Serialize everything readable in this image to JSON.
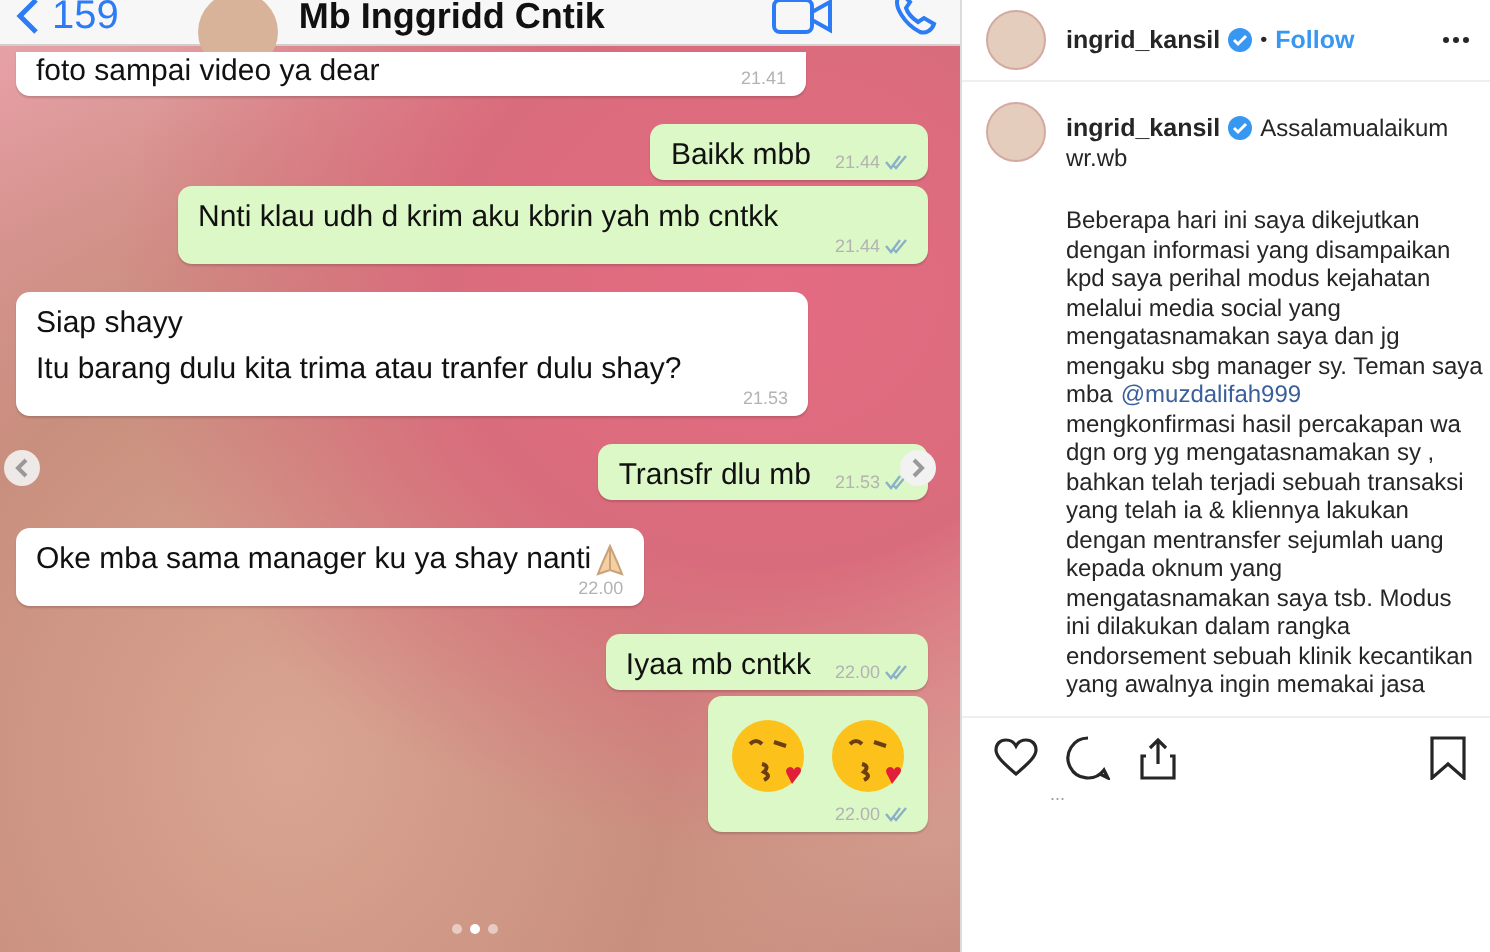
{
  "chat": {
    "back_count": "159",
    "contact": "Mb Inggridd Cntik",
    "messages": [
      {
        "kind": "in",
        "lines": [
          "foto sampai video ya dear"
        ],
        "time": "21.41"
      },
      {
        "kind": "out",
        "lines": [
          "Baikk mbb"
        ],
        "time": "21.44"
      },
      {
        "kind": "out",
        "lines": [
          "Nnti klau udh d krim aku kbrin yah mb cntkk"
        ],
        "time": "21.44"
      },
      {
        "kind": "in",
        "lines": [
          "Siap shayy",
          "Itu barang dulu kita trima atau tranfer dulu shay?"
        ],
        "time": "21.53"
      },
      {
        "kind": "out",
        "lines": [
          "Transfr dlu mb"
        ],
        "time": "21.53"
      },
      {
        "kind": "in-pray",
        "lines": [
          "Oke mba sama manager ku ya shay nanti"
        ],
        "time": "22.00"
      },
      {
        "kind": "out",
        "lines": [
          "Iyaa mb cntkk"
        ],
        "time": "22.00"
      },
      {
        "kind": "out-emoji",
        "time": "22.00"
      }
    ]
  },
  "carousel": {
    "dots": [
      {
        "selected": false
      },
      {
        "selected": true
      },
      {
        "selected": false
      }
    ]
  },
  "post": {
    "username": "ingrid_kansil",
    "separator": "•",
    "follow": "Follow",
    "caption_username": "ingrid_kansil",
    "caption_first": "Assalamualaikum",
    "caption_second": "wr.wb",
    "caption_lines": [
      {
        "text": "Beberapa hari ini saya dikejutkan"
      },
      {
        "text": "dengan informasi yang disampaikan"
      },
      {
        "text": "kpd saya perihal modus kejahatan"
      },
      {
        "text": "melalui media social yang"
      },
      {
        "text": "mengatasnamakan saya dan jg"
      },
      {
        "text": "mengaku sbg manager sy. Teman saya"
      },
      {
        "text": "mba",
        "mention": "@muzdalifah999"
      },
      {
        "text": "mengkonfirmasi hasil percakapan wa"
      },
      {
        "text": "dgn org yg mengatasnamakan sy ,"
      },
      {
        "text": "bahkan telah terjadi sebuah transaksi"
      },
      {
        "text": "yang telah ia & kliennya lakukan"
      },
      {
        "text": "dengan mentransfer sejumlah uang"
      },
      {
        "text": "kepada oknum yang"
      },
      {
        "text": "mengatasnamakan saya tsb. Modus"
      },
      {
        "text": "ini dilakukan dalam rangka"
      },
      {
        "text": "endorsement sebuah klinik kecantikan"
      },
      {
        "text": "yang awalnya ingin memakai jasa"
      }
    ],
    "more": "..."
  }
}
